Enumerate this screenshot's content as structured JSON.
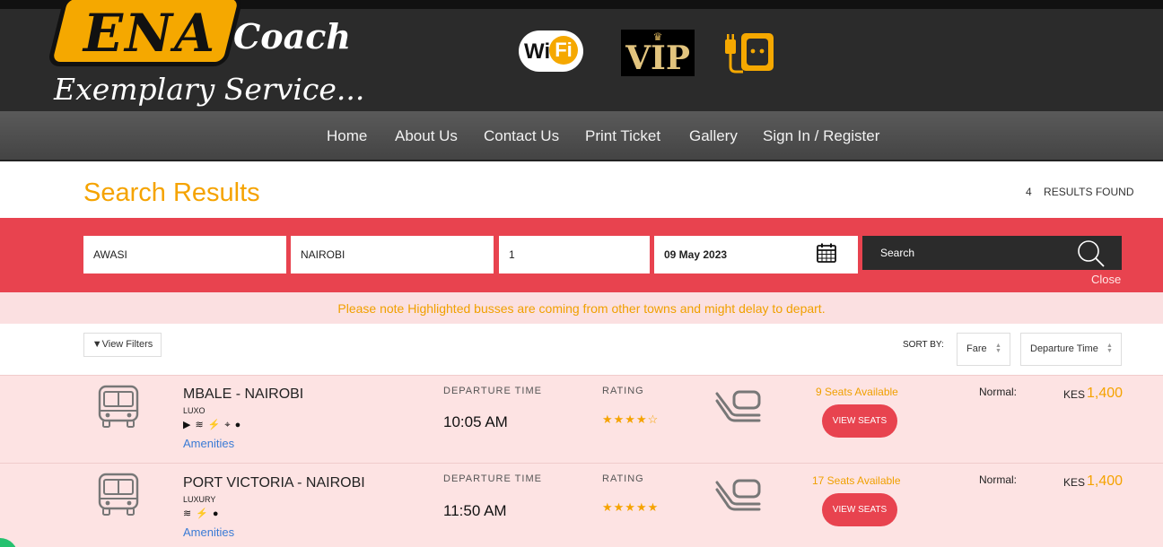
{
  "brand": {
    "logo_mark": "ENA",
    "logo_word": "Coach",
    "tagline": "Exemplary Service...",
    "badges": {
      "wifi_wi": "Wi",
      "wifi_fi": "Fi",
      "vip": "VIP",
      "power_icon": "power-plug-icon"
    },
    "colors": {
      "accent": "#f5a300",
      "brand_red": "#e8434f",
      "header_bg": "#2b2b2b"
    }
  },
  "nav": {
    "items": [
      "Home",
      "About Us",
      "Contact Us",
      "Print Ticket",
      "Gallery",
      "Sign In / Register"
    ]
  },
  "page": {
    "title": "Search Results",
    "results_count": "4",
    "results_label": "RESULTS FOUND"
  },
  "search": {
    "from": "AWASI",
    "to": "NAIROBI",
    "passengers": "1",
    "date": "09 May 2023",
    "button_label": "Search",
    "close_label": "Close"
  },
  "notice": "Please note Highlighted busses are coming from other towns and might delay to depart.",
  "filters": {
    "view_filters_label": "View Filters",
    "sort_label": "SORT BY:",
    "sort_fare": "Fare",
    "sort_departure": "Departure Time"
  },
  "labels": {
    "departure_time": "DEPARTURE TIME",
    "rating": "RATING",
    "amenities": "Amenities",
    "view_seats": "VIEW SEATS",
    "fare_class": "Normal:",
    "currency": "KES"
  },
  "results": [
    {
      "route": "MBALE - NAIROBI",
      "bus_class": "LUXO",
      "amenity_icons": [
        "play-icon",
        "wifi-icon",
        "plug-icon",
        "location-icon",
        "water-drop-icon"
      ],
      "departure_time": "10:05 AM",
      "rating": 4,
      "seats_available": "9 Seats Available",
      "fare": "1,400"
    },
    {
      "route": "PORT VICTORIA - NAIROBI",
      "bus_class": "LUXURY",
      "amenity_icons": [
        "wifi-icon",
        "plug-icon",
        "water-drop-icon"
      ],
      "departure_time": "11:50 AM",
      "rating": 5,
      "seats_available": "17 Seats Available",
      "fare": "1,400"
    }
  ]
}
